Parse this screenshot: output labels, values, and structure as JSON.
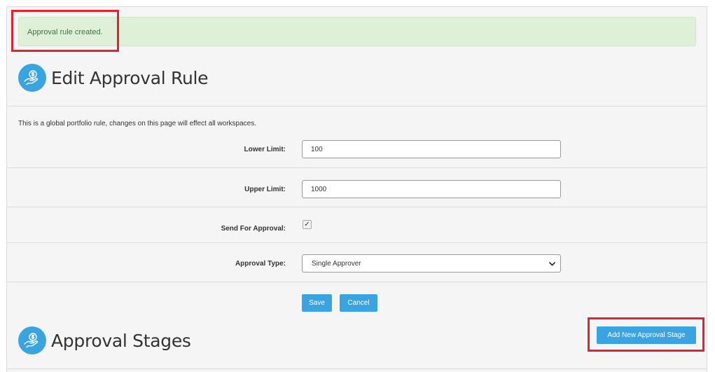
{
  "alert": {
    "message": "Approval rule created."
  },
  "header": {
    "title": "Edit Approval Rule",
    "icon": "money-hand-icon"
  },
  "form": {
    "intro": "This is a global portfolio rule, changes on this page will effect all workspaces.",
    "lower_limit": {
      "label": "Lower Limit:",
      "value": "100"
    },
    "upper_limit": {
      "label": "Upper Limit:",
      "value": "1000"
    },
    "send_for_approval": {
      "label": "Send For Approval:",
      "checked": true,
      "check_glyph": "✓"
    },
    "approval_type": {
      "label": "Approval Type:",
      "value": "Single Approver"
    },
    "save_label": "Save",
    "cancel_label": "Cancel"
  },
  "stages": {
    "title": "Approval Stages",
    "icon": "money-hand-icon",
    "add_label": "Add New Approval Stage"
  },
  "colors": {
    "accent": "#3aa4e0",
    "success_bg": "#dff0d8",
    "success_text": "#3c763d",
    "highlight": "#e0242f"
  }
}
